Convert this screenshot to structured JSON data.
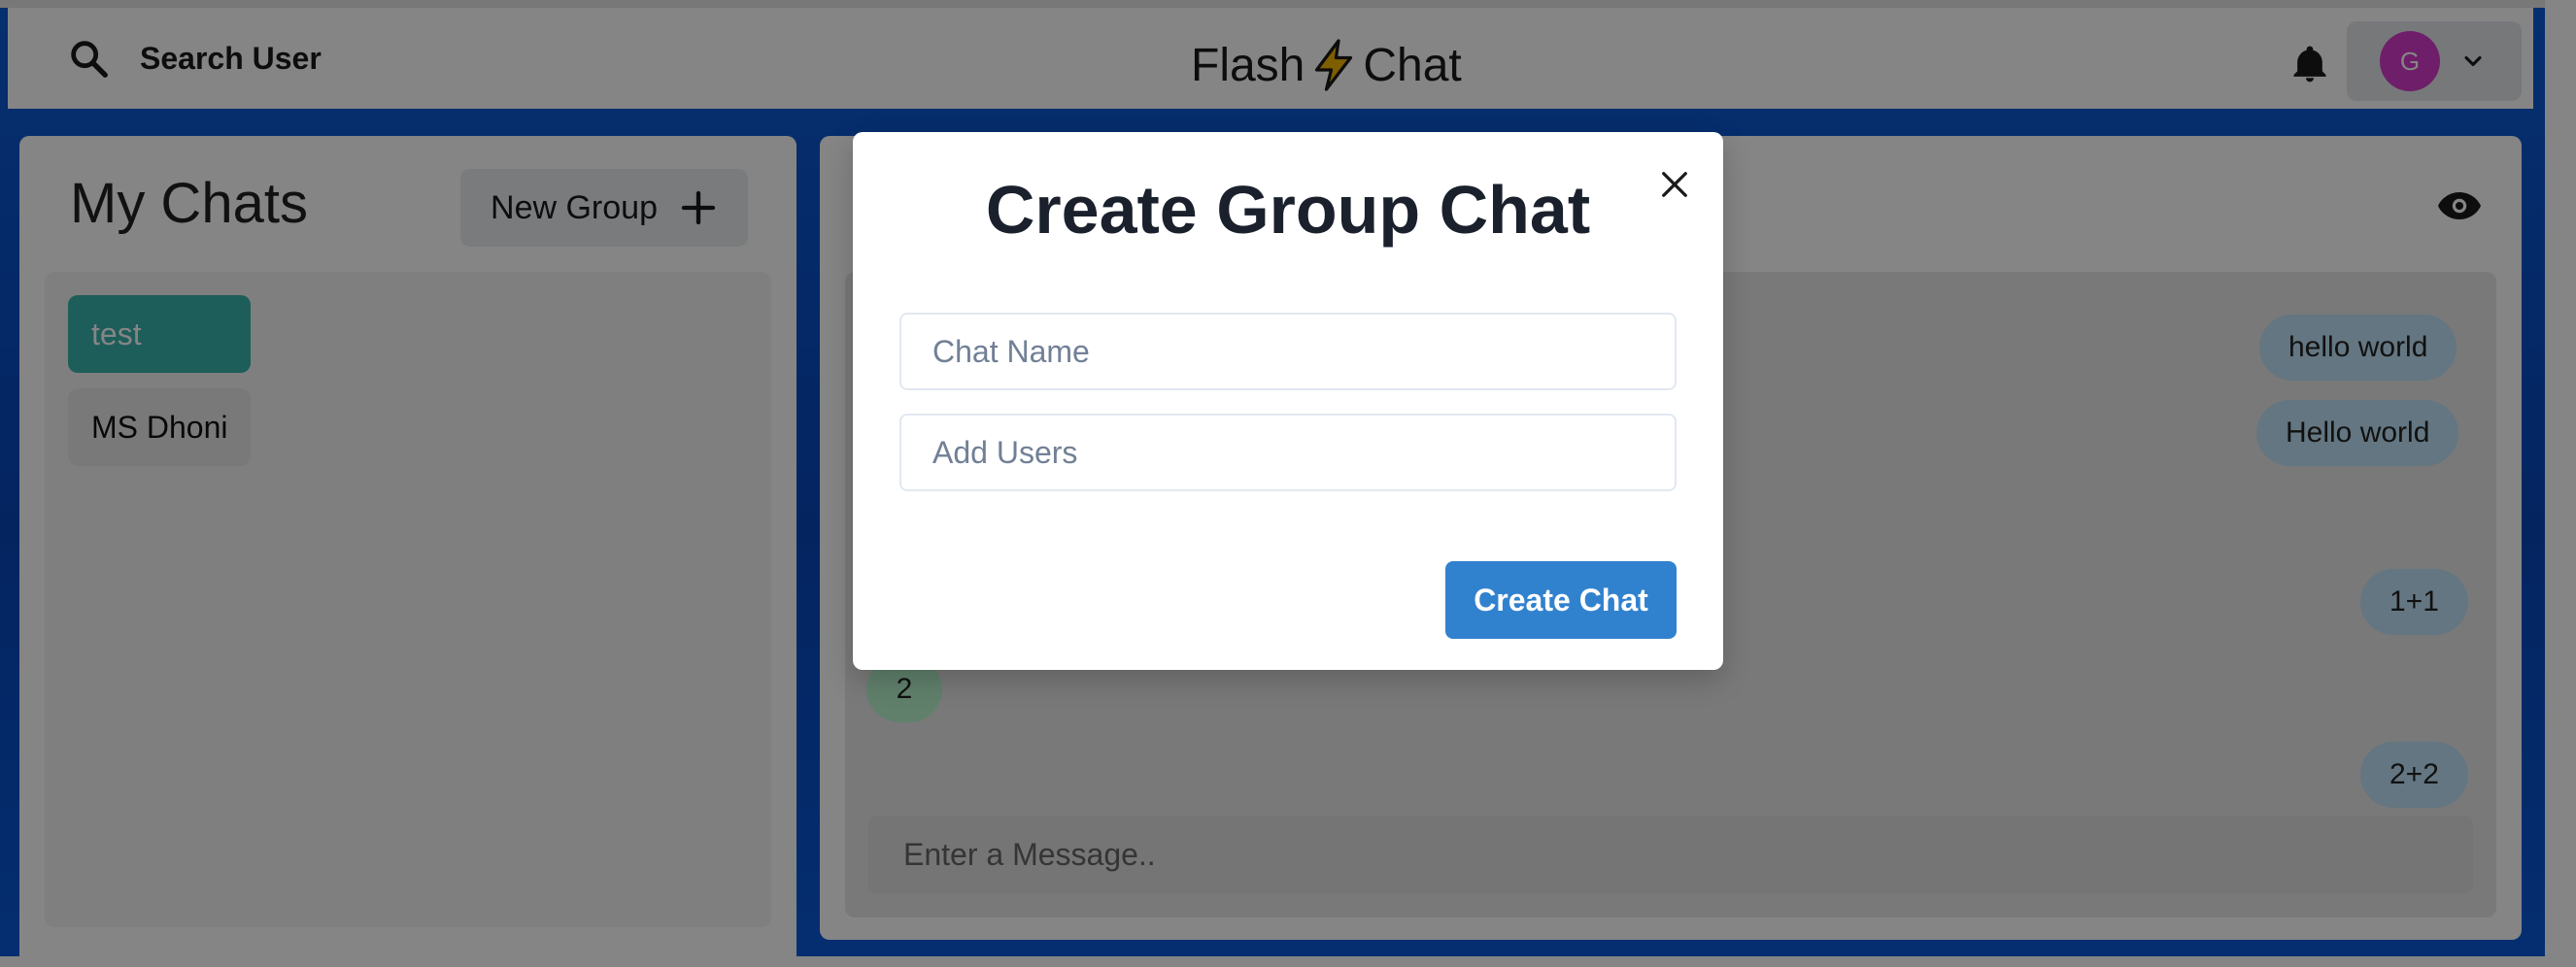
{
  "header": {
    "search_label": "Search User",
    "logo_text_left": "Flash",
    "logo_text_right": "Chat",
    "logo_icon": "lightning-bolt-icon",
    "avatar_initial": "G",
    "avatar_color": "#d53ac9"
  },
  "sidebar": {
    "title": "My Chats",
    "new_group_label": "New Group",
    "chats": [
      {
        "name": "test",
        "active": true
      },
      {
        "name": "MS Dhoni",
        "active": false
      }
    ]
  },
  "chat": {
    "messages": [
      {
        "text": "hello world",
        "side": "sent"
      },
      {
        "text": "Hello world",
        "side": "sent"
      },
      {
        "text": "1+1",
        "side": "sent"
      },
      {
        "text": "2",
        "side": "received"
      },
      {
        "text": "2+2",
        "side": "sent"
      }
    ],
    "input_placeholder": "Enter a Message.."
  },
  "modal": {
    "title": "Create Group Chat",
    "chat_name_placeholder": "Chat Name",
    "add_users_placeholder": "Add Users",
    "submit_label": "Create Chat"
  },
  "colors": {
    "accent": "#3182ce",
    "active_chat": "#38b2ac",
    "sent_bubble": "#bee3f8",
    "received_bubble": "#b9f5d0",
    "background": "#0846b8"
  }
}
